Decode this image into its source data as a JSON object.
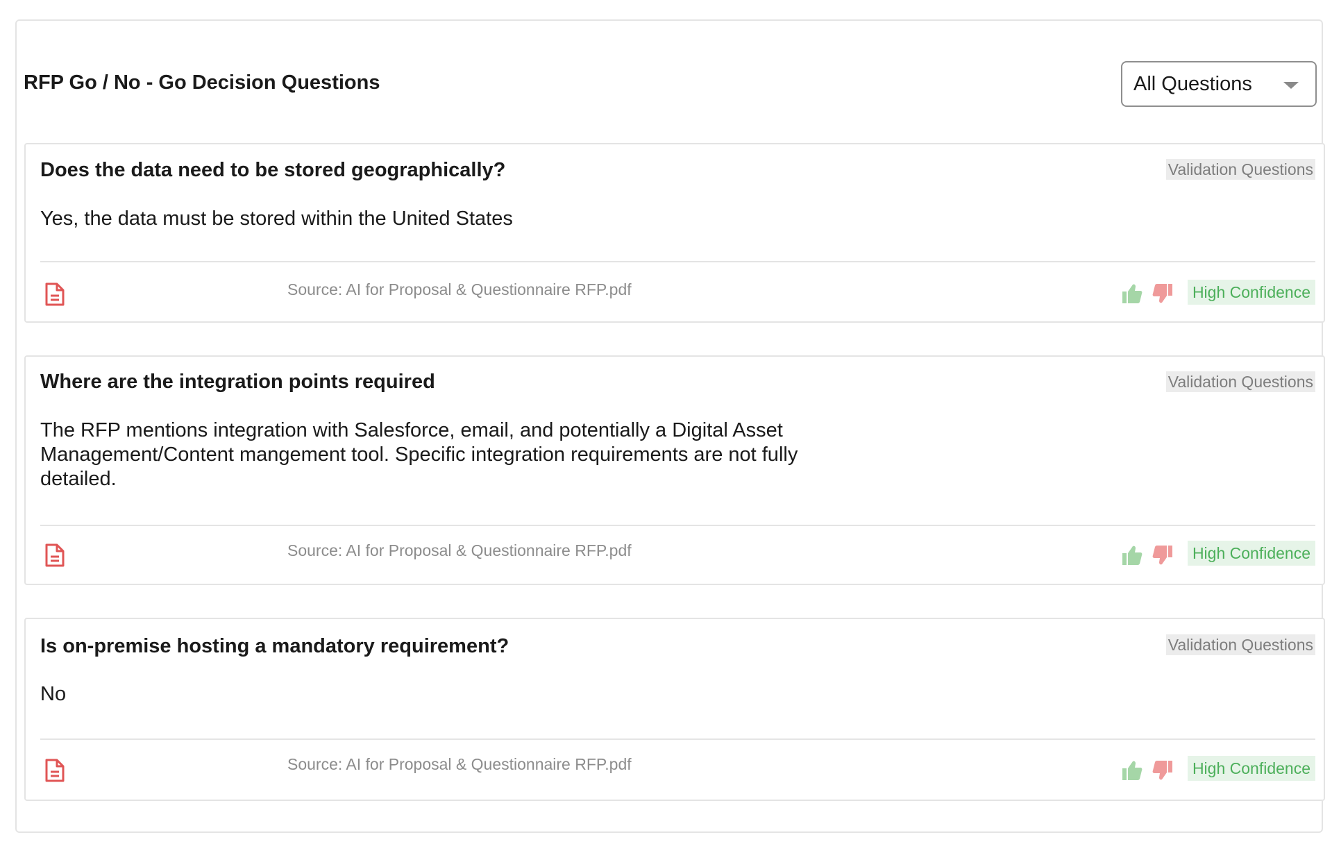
{
  "header": {
    "title": "RFP Go / No - Go Decision Questions",
    "filter": {
      "selected": "All Questions",
      "icon": "chevron-down-icon"
    }
  },
  "questions": [
    {
      "title": "Does the data need to be stored geographically?",
      "tag": "Validation Questions",
      "answer": "Yes, the data must be stored within the United States",
      "source": "Source: AI for Proposal & Questionnaire RFP.pdf",
      "confidence": "High Confidence"
    },
    {
      "title": "Where are the integration points required",
      "tag": "Validation Questions",
      "answer": "The RFP mentions integration with Salesforce, email, and potentially a Digital Asset Management/Content mangement tool. Specific integration requirements are not fully detailed.",
      "source": "Source: AI for Proposal & Questionnaire RFP.pdf",
      "confidence": "High Confidence"
    },
    {
      "title": "Is on-premise hosting a mandatory requirement?",
      "tag": "Validation Questions",
      "answer": "No",
      "source": "Source: AI for Proposal & Questionnaire RFP.pdf",
      "confidence": "High Confidence"
    }
  ],
  "icons": {
    "document": "document-icon",
    "thumbs_up": "thumbs-up-icon",
    "thumbs_down": "thumbs-down-icon"
  },
  "colors": {
    "document_icon": "#e05555",
    "thumbs_up": "#a5d6a7",
    "thumbs_down": "#ef9a9a",
    "confidence_bg": "#e6f4e8",
    "confidence_text": "#4caf5a",
    "tag_bg": "#ececec",
    "tag_text": "#7d7d7d"
  }
}
